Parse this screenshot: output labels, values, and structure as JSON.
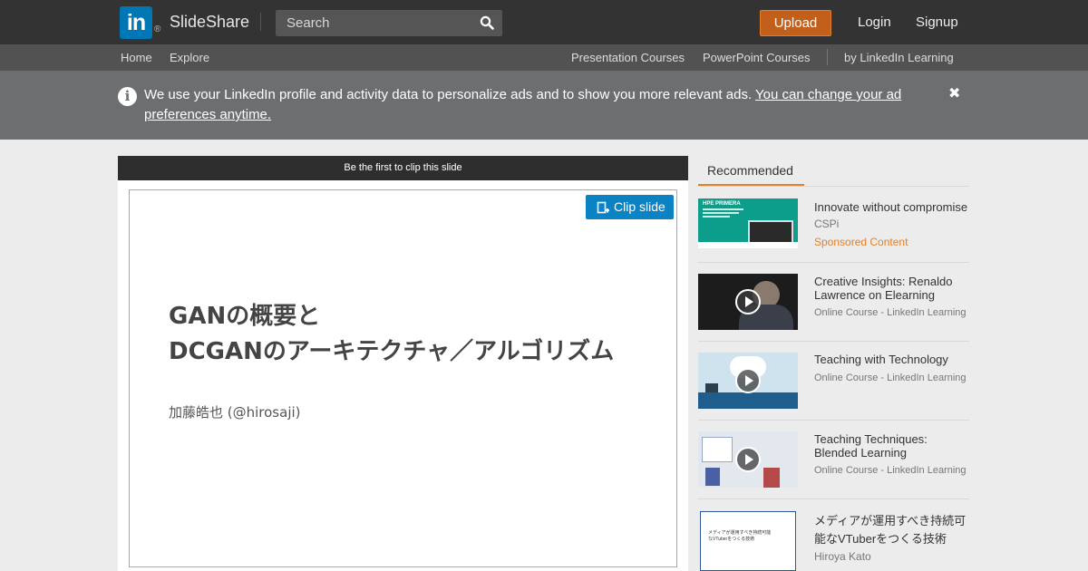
{
  "header": {
    "logo_text": "in",
    "logo_mark": "®",
    "brand": "SlideShare",
    "search_placeholder": "Search",
    "upload_label": "Upload",
    "login_label": "Login",
    "signup_label": "Signup"
  },
  "subnav": {
    "home": "Home",
    "explore": "Explore",
    "presentation_courses": "Presentation Courses",
    "powerpoint_courses": "PowerPoint Courses",
    "linkedin_learning": "by LinkedIn Learning"
  },
  "notice": {
    "text": "We use your LinkedIn profile and activity data to personalize ads and to show you more relevant ads. ",
    "link": "You can change your ad preferences anytime.",
    "close": "✖"
  },
  "slide": {
    "clip_bar": "Be the first to clip this slide",
    "clip_button": "Clip slide",
    "title_line1": "GANの概要と",
    "title_line2": "DCGANのアーキテクチャ／アルゴリズム",
    "author": "加藤皓也 (@hirosaji)"
  },
  "recommended": {
    "tab": "Recommended",
    "items": [
      {
        "title": "Innovate without compromise",
        "sub1": "CSPi",
        "sub2": "Sponsored Content",
        "thumb_text": "HPE PRIMERA"
      },
      {
        "title": "Creative Insights: Renaldo Lawrence on Elearning",
        "sub1": "Online Course - LinkedIn Learning"
      },
      {
        "title": "Teaching with Technology",
        "sub1": "Online Course - LinkedIn Learning"
      },
      {
        "title": "Teaching Techniques: Blended Learning",
        "sub1": "Online Course - LinkedIn Learning"
      },
      {
        "title": "メディアが運用すべき持続可能なVTuberをつくる技術",
        "sub1": "Hiroya Kato",
        "thumb_text": "メディアが運用すべき持続可能なVTuberをつくる技術"
      }
    ]
  },
  "colors": {
    "topbar": "#333333",
    "subnav": "#525252",
    "notice": "#6d6e70",
    "upload": "#c15f1b",
    "clip_button": "#0b82c4",
    "accent_tab": "#e0812b",
    "sponsored": "#e0812b"
  }
}
